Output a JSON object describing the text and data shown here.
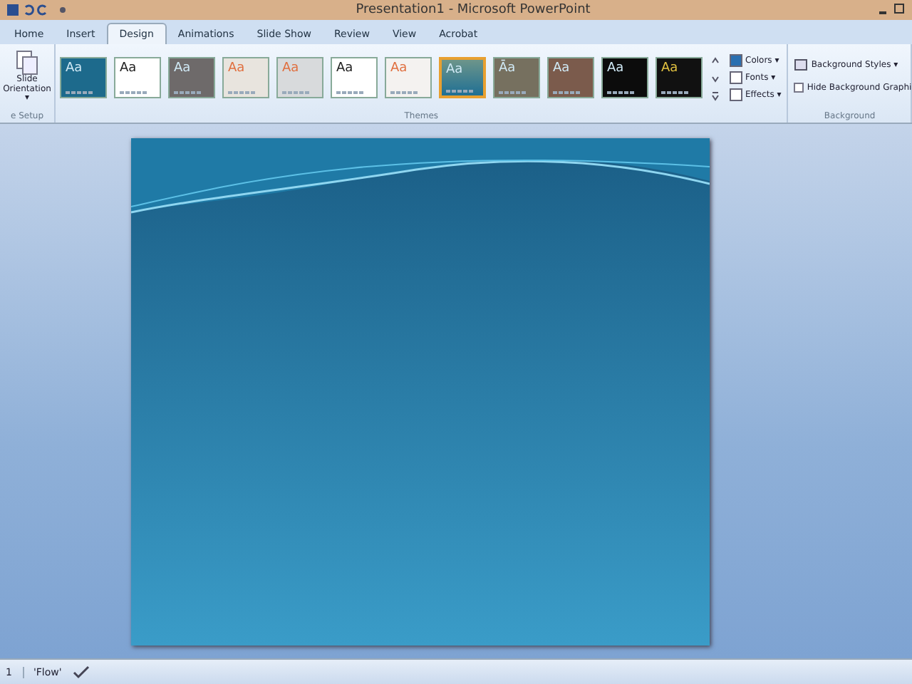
{
  "window": {
    "title": "Presentation1 - Microsoft PowerPoint"
  },
  "tabs": [
    {
      "label": "Home",
      "selected": false
    },
    {
      "label": "Insert",
      "selected": false
    },
    {
      "label": "Design",
      "selected": true
    },
    {
      "label": "Animations",
      "selected": false
    },
    {
      "label": "Slide Show",
      "selected": false
    },
    {
      "label": "Review",
      "selected": false
    },
    {
      "label": "View",
      "selected": false
    },
    {
      "label": "Acrobat",
      "selected": false
    }
  ],
  "page_setup": {
    "button": "Slide Orientation",
    "caret": "▾",
    "group_label": "e Setup"
  },
  "themes": {
    "group_label": "Themes",
    "items": [
      {
        "label": "Aa",
        "color": "#1d6a8c",
        "kind": "dark",
        "selected": false
      },
      {
        "label": "Aa",
        "color": "#ffffff",
        "kind": "light",
        "selected": false
      },
      {
        "label": "Aa",
        "color": "#6e6a6a",
        "kind": "dark",
        "selected": false
      },
      {
        "label": "Aa",
        "color": "#e8e4de",
        "kind": "accent",
        "selected": false
      },
      {
        "label": "Aa",
        "color": "#d8dadc",
        "kind": "accent",
        "selected": false
      },
      {
        "label": "Aa",
        "color": "#ffffff",
        "kind": "light",
        "selected": false
      },
      {
        "label": "Aa",
        "color": "#f4f2f0",
        "kind": "accent",
        "selected": false
      },
      {
        "label": "Aa",
        "color": "#1f6f94",
        "kind": "dark",
        "selected": true
      },
      {
        "label": "Āa",
        "color": "#76705f",
        "kind": "dark",
        "selected": false
      },
      {
        "label": "Aa",
        "color": "#7b5b4c",
        "kind": "dark",
        "selected": false
      },
      {
        "label": "Aa",
        "color": "#0c0c0c",
        "kind": "dark",
        "selected": false
      },
      {
        "label": "Aa",
        "color": "#111111",
        "kind": "gold",
        "selected": false
      }
    ]
  },
  "theme_options": [
    {
      "label": "Colors",
      "caret": "▾"
    },
    {
      "label": "Fonts",
      "caret": "▾"
    },
    {
      "label": "Effects",
      "caret": "▾"
    }
  ],
  "background": {
    "styles_button": "Background Styles",
    "caret": "▾",
    "hide_graphics": {
      "label": "Hide Background Graphi",
      "checked": false
    },
    "group_label": "Background"
  },
  "status_bar": {
    "slide_number": "1",
    "theme_name": "'Flow'"
  }
}
